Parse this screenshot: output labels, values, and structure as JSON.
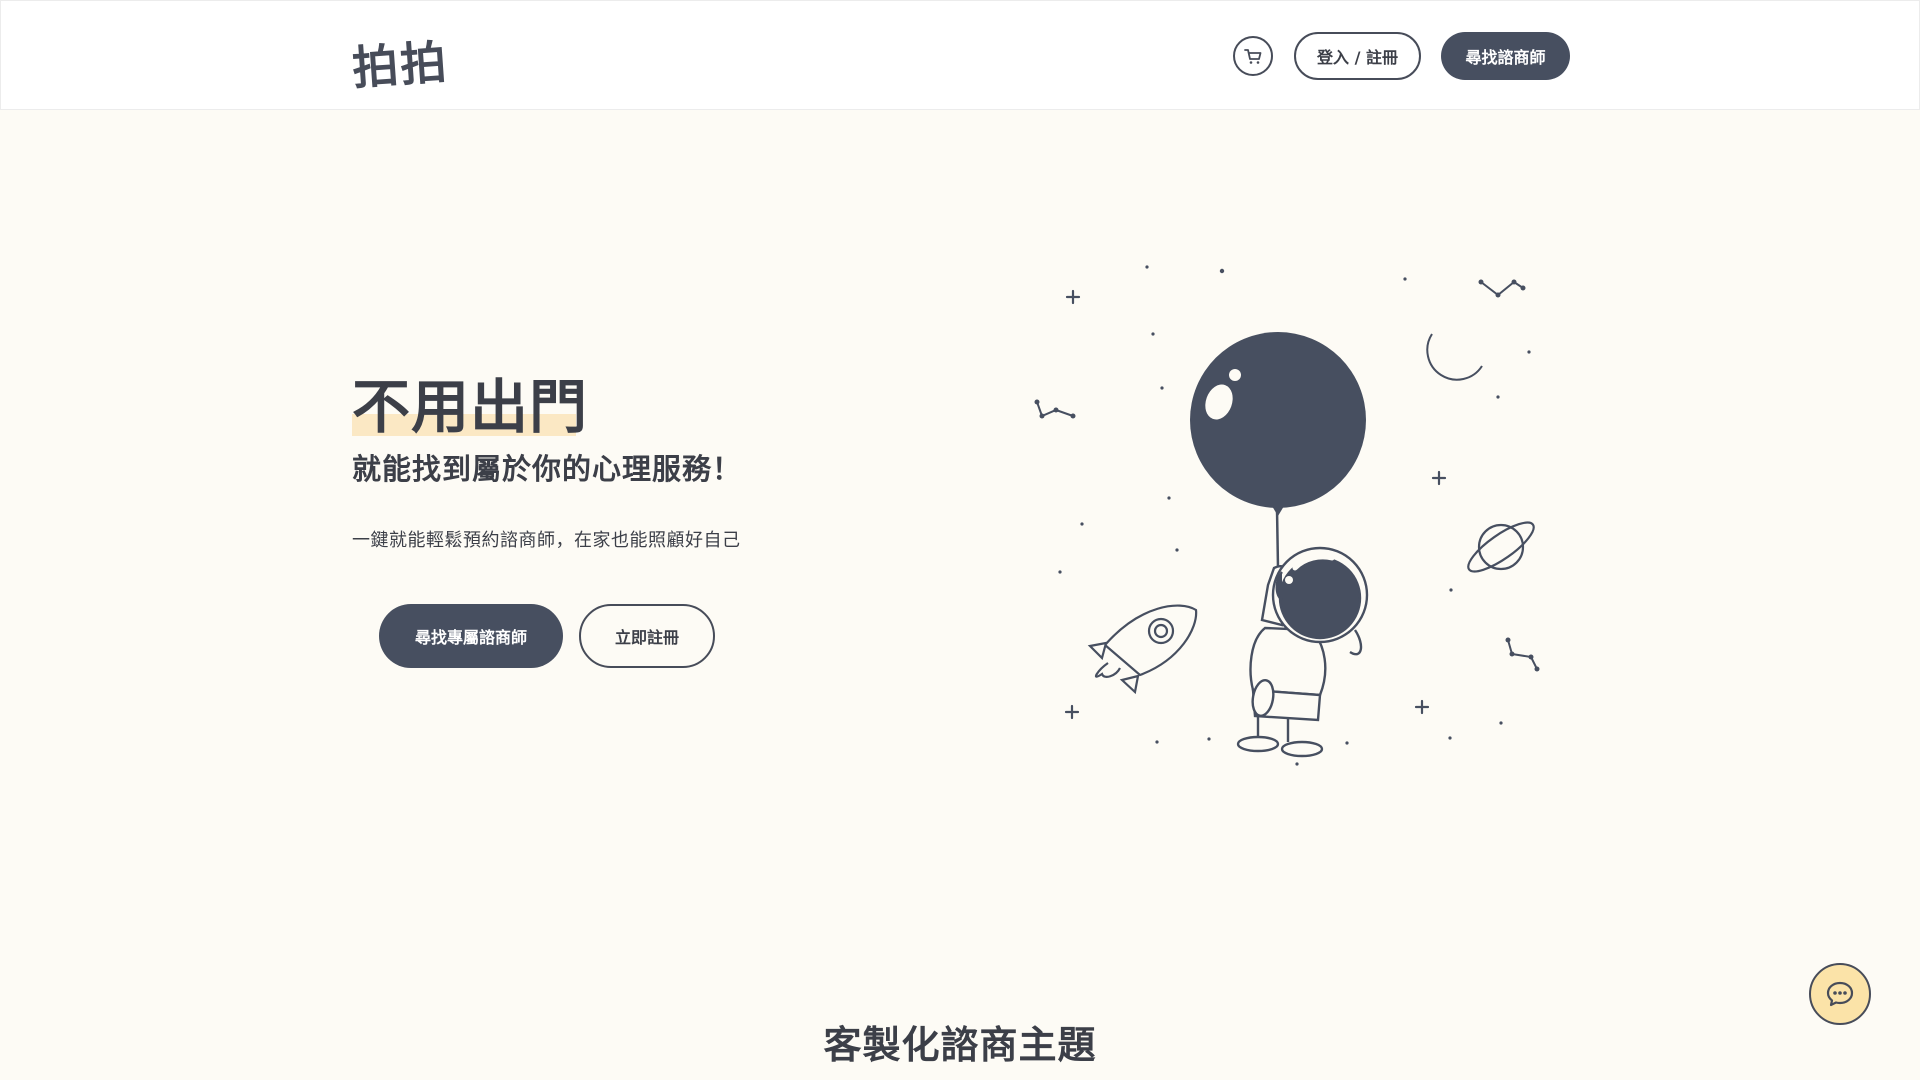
{
  "header": {
    "logo_text": "拍拍",
    "cart_icon": "cart-icon",
    "login_label": "登入 / 註冊",
    "find_counselor_label": "尋找諮商師"
  },
  "hero": {
    "title": "不用出門",
    "subtitle": "就能找到屬於你的心理服務！",
    "description": "一鍵就能輕鬆預約諮商師，在家也能照顧好自己",
    "primary_cta": "尋找專屬諮商師",
    "secondary_cta": "立即註冊",
    "illustration": "astronaut-balloon-illustration"
  },
  "section": {
    "title": "客製化諮商主題"
  },
  "chat": {
    "icon": "chat-bubble-icon"
  },
  "colors": {
    "background": "#fdfbf5",
    "primary": "#474f60",
    "highlight": "#fbe8c4",
    "chat_bg": "#fbe3a8"
  }
}
